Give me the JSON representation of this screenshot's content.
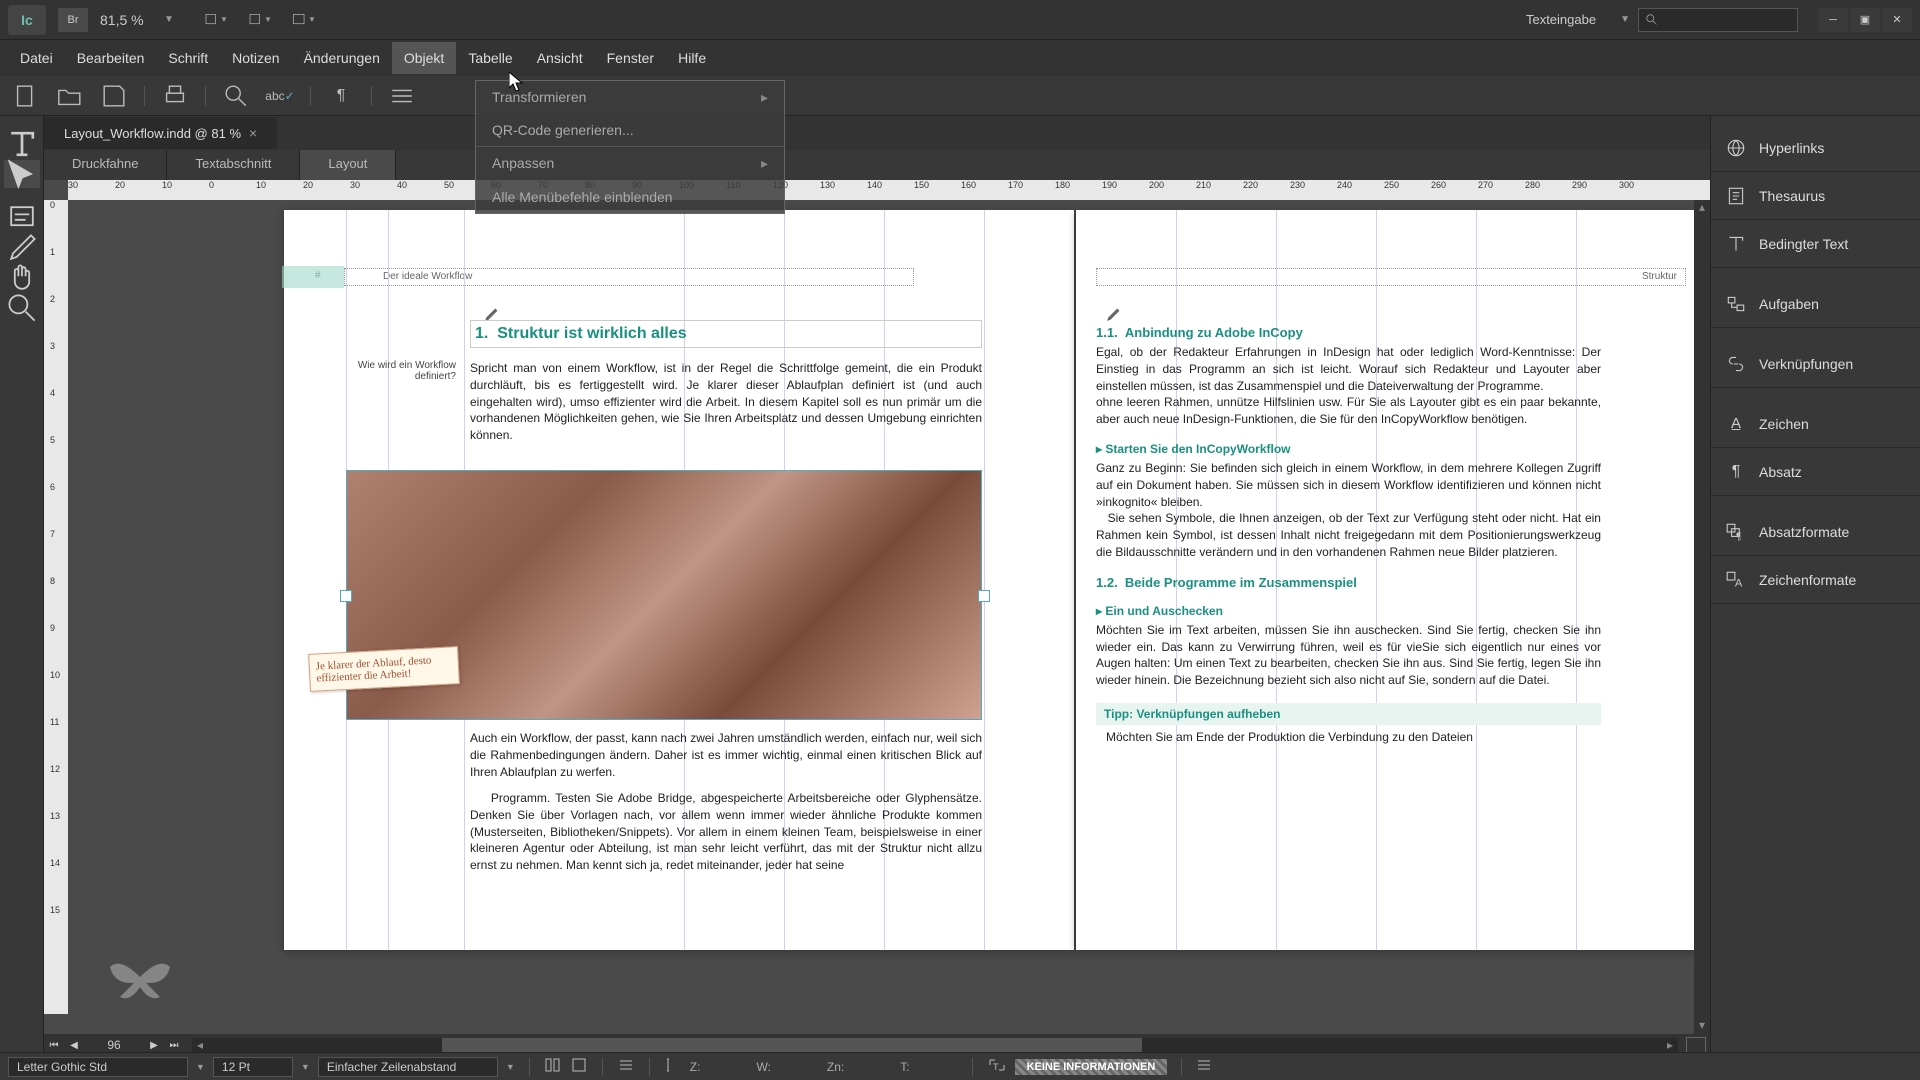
{
  "titlebar": {
    "app_logo": "Ic",
    "br_label": "Br",
    "zoom": "81,5 %",
    "workspace": "Texteingabe"
  },
  "menubar": {
    "items": [
      "Datei",
      "Bearbeiten",
      "Schrift",
      "Notizen",
      "Änderungen",
      "Objekt",
      "Tabelle",
      "Ansicht",
      "Fenster",
      "Hilfe"
    ]
  },
  "dropdown": {
    "items": [
      "Transformieren",
      "QR-Code generieren...",
      "Anpassen",
      "Alle Menübefehle einblenden"
    ]
  },
  "doc": {
    "tab_title": "Layout_Workflow.indd @ 81 %",
    "view_tabs": [
      "Druckfahne",
      "Textabschnitt",
      "Layout"
    ]
  },
  "ruler_h": [
    30,
    20,
    10,
    0,
    10,
    20,
    30,
    40,
    50,
    60,
    70,
    80,
    90,
    100,
    110,
    120,
    130,
    140,
    150,
    160,
    170,
    180,
    190,
    200,
    210,
    220,
    230,
    240,
    250,
    260,
    270,
    280,
    290,
    300
  ],
  "ruler_v": [
    0,
    1,
    2,
    3,
    4,
    5,
    6,
    7,
    8,
    9,
    10,
    11,
    12,
    13,
    14,
    15
  ],
  "page_left": {
    "header": "Der ideale Workflow",
    "heading_num": "1.",
    "heading": "Struktur ist wirklich alles",
    "side_q": "Wie wird ein Workflow definiert?",
    "para1": "Spricht man von einem Workflow, ist in der Regel die Schrittfolge gemeint, die ein Produkt durchläuft, bis es fertiggestellt wird. Je klarer dieser Ablaufplan definiert ist (und auch eingehalten wird), umso effizienter wird die Arbeit. In diesem Kapitel soll es nun primär um die vorhandenen Möglichkeiten gehen, wie Sie Ihren Arbeitsplatz und dessen Umgebung einrichten können.",
    "sticky": "Je klarer der Ablauf, desto effizienter die Arbeit!",
    "para2": "Auch ein Workflow, der passt, kann nach zwei Jahren umständlich werden, einfach nur, weil sich die Rahmenbedingungen ändern. Daher ist es immer wichtig, einmal einen kritischen Blick auf Ihren Ablaufplan zu werfen.",
    "para3": "Programm. Testen Sie Adobe Bridge, abgespeicherte Arbeitsbereiche oder Glyphensätze. Denken Sie über Vorlagen nach, vor allem wenn immer wieder ähnliche Produkte kommen (Musterseiten, Bibliotheken/Snippets). Vor allem in einem kleinen Team, beispielsweise in einer kleineren Agentur oder Abteilung, ist man sehr leicht verführt, das mit der Struktur nicht allzu ernst zu nehmen. Man kennt sich ja, redet miteinander, jeder hat seine"
  },
  "page_right": {
    "header": "Struktur",
    "h1_num": "1.1.",
    "h1": "Anbindung zu Adobe InCopy",
    "p1": "Egal, ob der Redakteur Erfahrungen in InDesign hat oder lediglich Word-Kenntnisse: Der Einstieg in das Programm an sich ist leicht. Worauf sich Redakteur und Layouter aber einstellen müssen, ist das Zusammenspiel und die Dateiverwaltung der Programme.",
    "p1b": "ohne leeren Rahmen, unnütze Hilfslinien usw. Für Sie als Layouter gibt es ein paar bekannte, aber auch neue InDesign-Funktionen, die Sie für den InCopyWorkflow benötigen.",
    "sh1": "▸  Starten Sie den InCopyWorkflow",
    "p2": "Ganz zu Beginn: Sie befinden sich gleich in einem Workflow, in dem mehrere Kollegen Zugriff auf ein Dokument haben. Sie müssen sich in diesem Workflow identifizieren und können nicht »inkognito« bleiben.",
    "p2b": "Sie sehen Symbole, die Ihnen anzeigen, ob der Text zur Verfügung steht oder nicht. Hat ein Rahmen kein Symbol, ist dessen Inhalt nicht freigegedann mit dem Positionierungswerkzeug die Bildausschnitte verändern und in den vorhandenen Rahmen neue Bilder platzieren.",
    "h2_num": "1.2.",
    "h2": "Beide Programme im Zusammenspiel",
    "sh2": "▸  Ein und Auschecken",
    "p3": "Möchten Sie im Text arbeiten, müssen Sie ihn auschecken. Sind Sie fertig, checken Sie ihn wieder ein. Das kann zu Verwirrung führen, weil es für vieSie sich eigentlich nur eines vor Augen halten: Um einen Text zu bearbeiten, checken Sie ihn aus. Sind Sie fertig, legen Sie ihn wieder hinein. Die Bezeichnung bezieht sich also nicht auf Sie, sondern auf die Datei.",
    "tip": "Tipp: Verknüpfungen aufheben",
    "p4": "Möchten Sie am Ende der Produktion die Verbindung zu den Dateien"
  },
  "panels": [
    "Hyperlinks",
    "Thesaurus",
    "Bedingter Text",
    "Aufgaben",
    "Verknüpfungen",
    "Zeichen",
    "Absatz",
    "Absatzformate",
    "Zeichenformate"
  ],
  "status": {
    "page": "96"
  },
  "controlbar": {
    "font": "Letter Gothic Std",
    "size": "12 Pt",
    "leading": "Einfacher Zeilenabstand",
    "z_label": "Z:",
    "w_label": "W:",
    "zn_label": "Zn:",
    "t_label": "T:",
    "info": "KEINE INFORMATIONEN"
  }
}
